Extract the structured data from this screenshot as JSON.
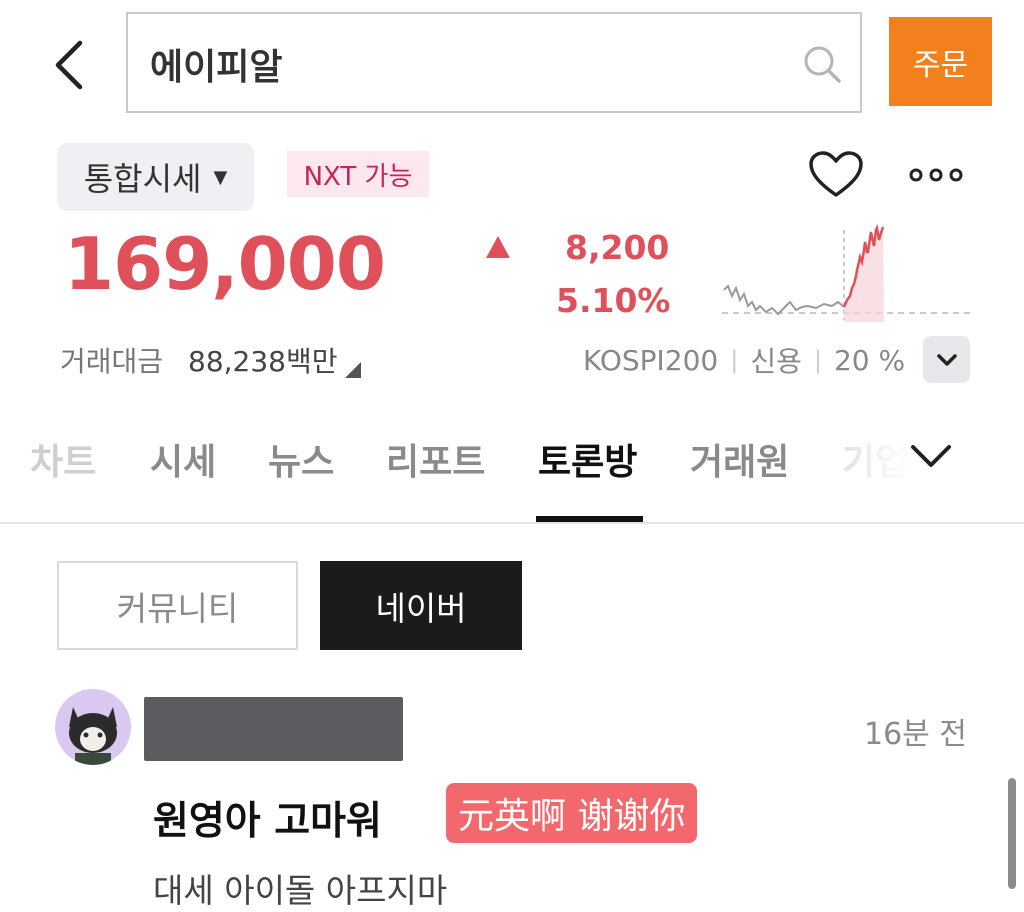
{
  "header": {
    "search_value": "에이피알",
    "order_label": "주문"
  },
  "market": {
    "dropdown_label": "통합시세",
    "nxt_badge": "NXT 가능"
  },
  "quote": {
    "price": "169,000",
    "change_amount": "8,200",
    "change_percent": "5.10%",
    "direction": "up",
    "up_color": "#e0505a",
    "volume_label": "거래대금",
    "volume_value": "88,238백만",
    "index_name": "KOSPI200",
    "credit_label": "신용",
    "credit_value": "20 %"
  },
  "tabs": [
    {
      "label": "차트"
    },
    {
      "label": "시세"
    },
    {
      "label": "뉴스"
    },
    {
      "label": "리포트"
    },
    {
      "label": "토론방",
      "active": true
    },
    {
      "label": "거래원"
    },
    {
      "label": "기업"
    }
  ],
  "segments": {
    "community": "커뮤니티",
    "naver": "네이버",
    "active": "naver"
  },
  "post": {
    "time": "16분 전",
    "title": "원영아 고마워",
    "translation": "元英啊 谢谢你",
    "preview": "대세 아이돌 아프지마"
  },
  "icons": {
    "back": "chevron-left-icon",
    "search": "search-icon",
    "favorite": "heart-icon",
    "more": "more-dots-icon",
    "expand": "chevron-down-icon",
    "tabs_more": "chevron-down-icon"
  },
  "colors": {
    "accent_order": "#f2811d",
    "price_up": "#e0505a",
    "nxt_text": "#c4245a"
  }
}
